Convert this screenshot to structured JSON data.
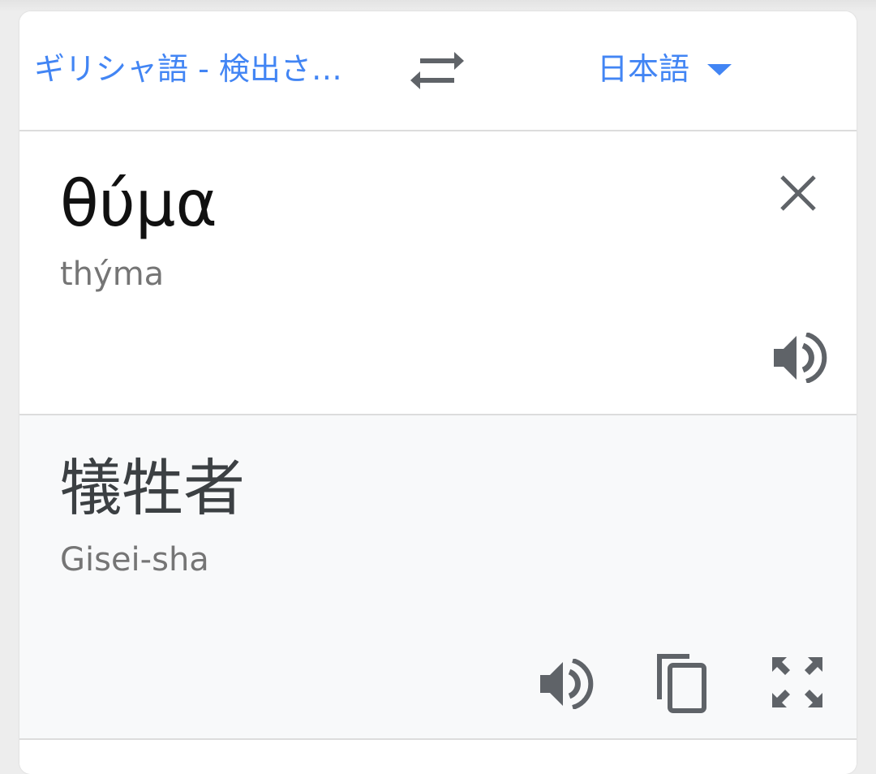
{
  "language_bar": {
    "source_language": "ギリシャ語 - 検出さ…",
    "target_language": "日本語",
    "swap_icon": "swap-arrows-icon",
    "dropdown_icon": "dropdown-triangle-icon"
  },
  "source": {
    "text": "θύμα",
    "transliteration": "thýma",
    "clear_icon": "close-icon",
    "listen_icon": "speaker-icon"
  },
  "result": {
    "text": "犠牲者",
    "transliteration": "Gisei-sha",
    "listen_icon": "speaker-icon",
    "copy_icon": "copy-icon",
    "fullscreen_icon": "fullscreen-icon"
  },
  "colors": {
    "accent": "#4285f4",
    "icon": "#5f6368",
    "result_background": "#f8f9fa",
    "divider": "#dcdcdc"
  }
}
